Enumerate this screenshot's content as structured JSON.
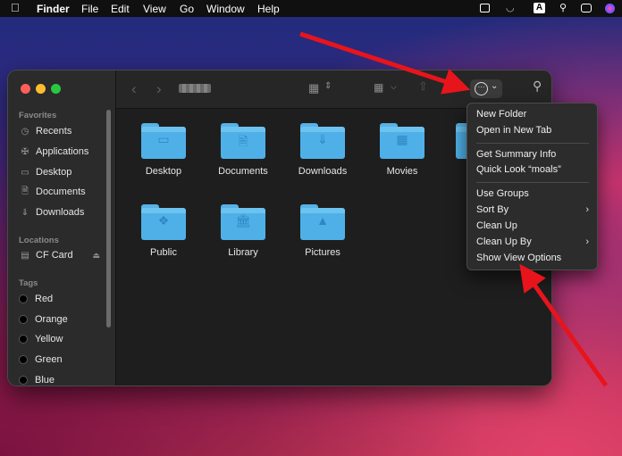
{
  "menubar": {
    "apple": "",
    "items": [
      "Finder",
      "File",
      "Edit",
      "View",
      "Go",
      "Window",
      "Help"
    ],
    "status_letter": "A"
  },
  "sidebar": {
    "favorites_header": "Favorites",
    "favorites": [
      "Recents",
      "Applications",
      "Desktop",
      "Documents",
      "Downloads"
    ],
    "locations_header": "Locations",
    "locations": [
      "CF Card"
    ],
    "tags_header": "Tags",
    "tags": [
      "Red",
      "Orange",
      "Yellow",
      "Green",
      "Blue"
    ]
  },
  "folders": [
    "Desktop",
    "Documents",
    "Downloads",
    "Movies",
    "Public",
    "Library",
    "Pictures"
  ],
  "context_menu": {
    "items": [
      "New Folder",
      "Open in New Tab",
      "Get Summary Info",
      "Quick Look “moals”",
      "Use Groups",
      "Sort By",
      "Clean Up",
      "Clean Up By",
      "Show View Options"
    ]
  },
  "colors": {
    "folder_blue": "#4fb0e8",
    "arrow_red": "#e8141c",
    "window_bg": "#1e1e1e"
  }
}
